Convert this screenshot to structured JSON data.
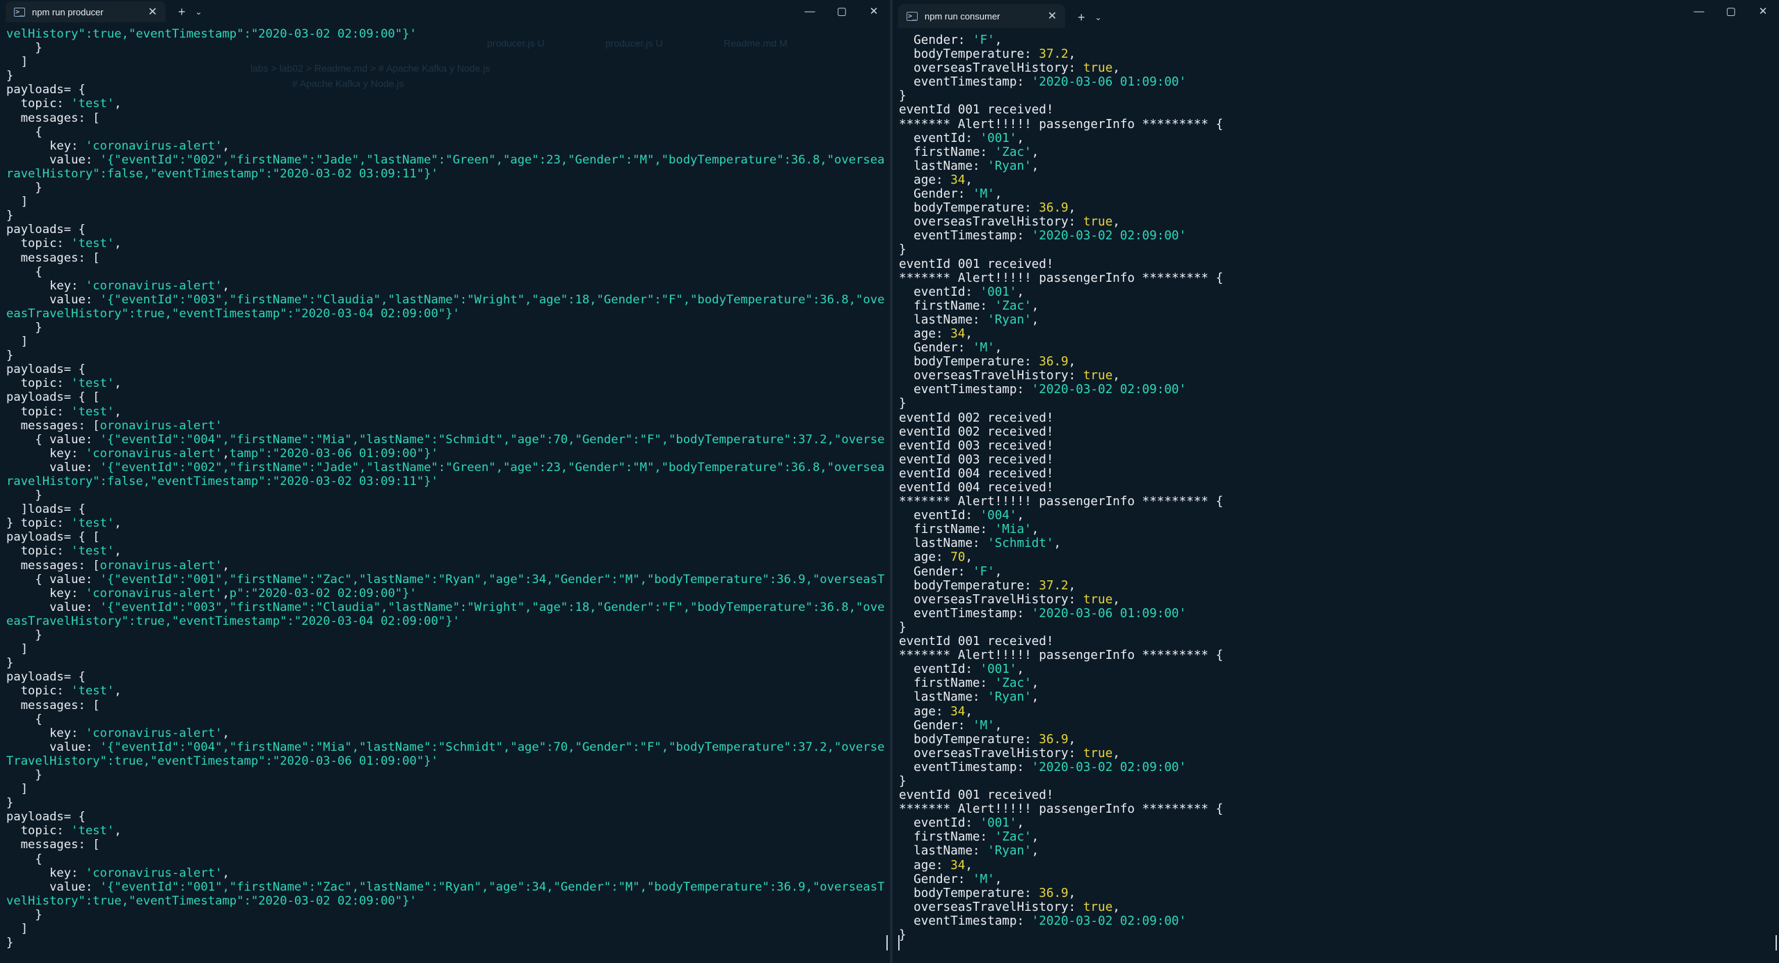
{
  "left_window": {
    "tab_title": "npm run producer",
    "tab_icon": "terminal-icon",
    "new_tab": "+",
    "dropdown": "⌄",
    "controls": {
      "minimize": "—",
      "maximize": "▢",
      "close": "✕"
    },
    "lines": [
      [
        {
          "t": "velHistory\":true,\"eventTimestamp\":\"2020-03-02 02:09:00\"}'",
          "c": "s"
        }
      ],
      [
        {
          "t": "    }"
        }
      ],
      [
        {
          "t": "  ]"
        }
      ],
      [
        {
          "t": "}"
        }
      ],
      [
        {
          "t": "payloads= {"
        }
      ],
      [
        {
          "t": "  topic: "
        },
        {
          "t": "'test'",
          "c": "s"
        },
        {
          "t": ","
        }
      ],
      [
        {
          "t": "  messages: ["
        }
      ],
      [
        {
          "t": "    {"
        }
      ],
      [
        {
          "t": "      key: "
        },
        {
          "t": "'coronavirus-alert'",
          "c": "s"
        },
        {
          "t": ","
        }
      ],
      [
        {
          "t": "      value: "
        },
        {
          "t": "'{\"eventId\":\"002\",\"firstName\":\"Jade\",\"lastName\":\"Green\",\"age\":23,\"Gender\":\"M\",\"bodyTemperature\":36.8,\"overseasT",
          "c": "s"
        }
      ],
      [
        {
          "t": "ravelHistory\":false,\"eventTimestamp\":\"2020-03-02 03:09:11\"}'",
          "c": "s"
        }
      ],
      [
        {
          "t": "    }"
        }
      ],
      [
        {
          "t": "  ]"
        }
      ],
      [
        {
          "t": "}"
        }
      ],
      [
        {
          "t": "payloads= {"
        }
      ],
      [
        {
          "t": "  topic: "
        },
        {
          "t": "'test'",
          "c": "s"
        },
        {
          "t": ","
        }
      ],
      [
        {
          "t": "  messages: ["
        }
      ],
      [
        {
          "t": "    {"
        }
      ],
      [
        {
          "t": "      key: "
        },
        {
          "t": "'coronavirus-alert'",
          "c": "s"
        },
        {
          "t": ","
        }
      ],
      [
        {
          "t": "      value: "
        },
        {
          "t": "'{\"eventId\":\"003\",\"firstName\":\"Claudia\",\"lastName\":\"Wright\",\"age\":18,\"Gender\":\"F\",\"bodyTemperature\":36.8,\"overs",
          "c": "s"
        }
      ],
      [
        {
          "t": "easTravelHistory\":true,\"eventTimestamp\":\"2020-03-04 02:09:00\"}'",
          "c": "s"
        }
      ],
      [
        {
          "t": "    }"
        }
      ],
      [
        {
          "t": "  ]"
        }
      ],
      [
        {
          "t": "}"
        }
      ],
      [
        {
          "t": "payloads= {"
        }
      ],
      [
        {
          "t": "  topic: "
        },
        {
          "t": "'test'",
          "c": "s"
        },
        {
          "t": ","
        }
      ],
      [
        {
          "t": "payloads= { ["
        }
      ],
      [
        {
          "t": "  topic: "
        },
        {
          "t": "'test'",
          "c": "s"
        },
        {
          "t": ","
        }
      ],
      [
        {
          "t": "  messages: ["
        },
        {
          "t": "oronavirus-alert'",
          "c": "s"
        }
      ],
      [
        {
          "t": "    { value: "
        },
        {
          "t": "'{\"eventId\":\"004\",\"firstName\":\"Mia\",\"lastName\":\"Schmidt\",\"age\":70,\"Gender\":\"F\",\"bodyTemperature\":37.2,\"overseas",
          "c": "s"
        }
      ],
      [
        {
          "t": "      key: "
        },
        {
          "t": "'coronavirus-alert'",
          "c": "s"
        },
        {
          "t": ","
        },
        {
          "t": "tamp\":\"2020-03-06 01:09:00\"}'",
          "c": "s"
        }
      ],
      [
        {
          "t": "      value: "
        },
        {
          "t": "'{\"eventId\":\"002\",\"firstName\":\"Jade\",\"lastName\":\"Green\",\"age\":23,\"Gender\":\"M\",\"bodyTemperature\":36.8,\"overseasT",
          "c": "s"
        }
      ],
      [
        {
          "t": "ravelHistory\":false,\"eventTimestamp\":\"2020-03-02 03:09:11\"}'",
          "c": "s"
        }
      ],
      [
        {
          "t": "    }"
        }
      ],
      [
        {
          "t": "  ]loads= {"
        }
      ],
      [
        {
          "t": "} topic: "
        },
        {
          "t": "'test'",
          "c": "s"
        },
        {
          "t": ","
        }
      ],
      [
        {
          "t": "payloads= { ["
        }
      ],
      [
        {
          "t": "  topic: "
        },
        {
          "t": "'test'",
          "c": "s"
        },
        {
          "t": ","
        }
      ],
      [
        {
          "t": "  messages: ["
        },
        {
          "t": "oronavirus-alert'",
          "c": "s"
        },
        {
          "t": ","
        }
      ],
      [
        {
          "t": "    { value: "
        },
        {
          "t": "'{\"eventId\":\"001\",\"firstName\":\"Zac\",\"lastName\":\"Ryan\",\"age\":34,\"Gender\":\"M\",\"bodyTemperature\":36.9,\"overseasTra",
          "c": "s"
        }
      ],
      [
        {
          "t": "      key: "
        },
        {
          "t": "'coronavirus-alert'",
          "c": "s"
        },
        {
          "t": ","
        },
        {
          "t": "p\":\"2020-03-02 02:09:00\"}'",
          "c": "s"
        }
      ],
      [
        {
          "t": "      value: "
        },
        {
          "t": "'{\"eventId\":\"003\",\"firstName\":\"Claudia\",\"lastName\":\"Wright\",\"age\":18,\"Gender\":\"F\",\"bodyTemperature\":36.8,\"overs",
          "c": "s"
        }
      ],
      [
        {
          "t": "easTravelHistory\":true,\"eventTimestamp\":\"2020-03-04 02:09:00\"}'",
          "c": "s"
        }
      ],
      [
        {
          "t": "    }"
        }
      ],
      [
        {
          "t": "  ]"
        }
      ],
      [
        {
          "t": "}"
        }
      ],
      [
        {
          "t": "payloads= {"
        }
      ],
      [
        {
          "t": "  topic: "
        },
        {
          "t": "'test'",
          "c": "s"
        },
        {
          "t": ","
        }
      ],
      [
        {
          "t": "  messages: ["
        }
      ],
      [
        {
          "t": "    {"
        }
      ],
      [
        {
          "t": "      key: "
        },
        {
          "t": "'coronavirus-alert'",
          "c": "s"
        },
        {
          "t": ","
        }
      ],
      [
        {
          "t": "      value: "
        },
        {
          "t": "'{\"eventId\":\"004\",\"firstName\":\"Mia\",\"lastName\":\"Schmidt\",\"age\":70,\"Gender\":\"F\",\"bodyTemperature\":37.2,\"overseas",
          "c": "s"
        }
      ],
      [
        {
          "t": "TravelHistory\":true,\"eventTimestamp\":\"2020-03-06 01:09:00\"}'",
          "c": "s"
        }
      ],
      [
        {
          "t": "    }"
        }
      ],
      [
        {
          "t": "  ]"
        }
      ],
      [
        {
          "t": "}"
        }
      ],
      [
        {
          "t": "payloads= {"
        }
      ],
      [
        {
          "t": "  topic: "
        },
        {
          "t": "'test'",
          "c": "s"
        },
        {
          "t": ","
        }
      ],
      [
        {
          "t": "  messages: ["
        }
      ],
      [
        {
          "t": "    {"
        }
      ],
      [
        {
          "t": "      key: "
        },
        {
          "t": "'coronavirus-alert'",
          "c": "s"
        },
        {
          "t": ","
        }
      ],
      [
        {
          "t": "      value: "
        },
        {
          "t": "'{\"eventId\":\"001\",\"firstName\":\"Zac\",\"lastName\":\"Ryan\",\"age\":34,\"Gender\":\"M\",\"bodyTemperature\":36.9,\"overseasTra",
          "c": "s"
        }
      ],
      [
        {
          "t": "velHistory\":true,\"eventTimestamp\":\"2020-03-02 02:09:00\"}'",
          "c": "s"
        }
      ],
      [
        {
          "t": "    }"
        }
      ],
      [
        {
          "t": "  ]"
        }
      ],
      [
        {
          "t": "}"
        }
      ]
    ]
  },
  "right_window": {
    "tab_title": "npm run consumer",
    "tab_icon": "terminal-icon",
    "new_tab": "+",
    "dropdown": "⌄",
    "controls": {
      "minimize": "—",
      "maximize": "▢",
      "close": "✕"
    },
    "lines": [
      [
        {
          "t": "  Gender: "
        },
        {
          "t": "'F'",
          "c": "s"
        },
        {
          "t": ","
        }
      ],
      [
        {
          "t": "  bodyTemperature: "
        },
        {
          "t": "37.2",
          "c": "n"
        },
        {
          "t": ","
        }
      ],
      [
        {
          "t": "  overseasTravelHistory: "
        },
        {
          "t": "true",
          "c": "b"
        },
        {
          "t": ","
        }
      ],
      [
        {
          "t": "  eventTimestamp: "
        },
        {
          "t": "'2020-03-06 01:09:00'",
          "c": "s"
        }
      ],
      [
        {
          "t": "}"
        }
      ],
      [
        {
          "t": "eventId 001 received!"
        }
      ],
      [
        {
          "t": "******* Alert!!!!! passengerInfo ********* {"
        }
      ],
      [
        {
          "t": "  eventId: "
        },
        {
          "t": "'001'",
          "c": "s"
        },
        {
          "t": ","
        }
      ],
      [
        {
          "t": "  firstName: "
        },
        {
          "t": "'Zac'",
          "c": "s"
        },
        {
          "t": ","
        }
      ],
      [
        {
          "t": "  lastName: "
        },
        {
          "t": "'Ryan'",
          "c": "s"
        },
        {
          "t": ","
        }
      ],
      [
        {
          "t": "  age: "
        },
        {
          "t": "34",
          "c": "n"
        },
        {
          "t": ","
        }
      ],
      [
        {
          "t": "  Gender: "
        },
        {
          "t": "'M'",
          "c": "s"
        },
        {
          "t": ","
        }
      ],
      [
        {
          "t": "  bodyTemperature: "
        },
        {
          "t": "36.9",
          "c": "n"
        },
        {
          "t": ","
        }
      ],
      [
        {
          "t": "  overseasTravelHistory: "
        },
        {
          "t": "true",
          "c": "b"
        },
        {
          "t": ","
        }
      ],
      [
        {
          "t": "  eventTimestamp: "
        },
        {
          "t": "'2020-03-02 02:09:00'",
          "c": "s"
        }
      ],
      [
        {
          "t": "}"
        }
      ],
      [
        {
          "t": "eventId 001 received!"
        }
      ],
      [
        {
          "t": "******* Alert!!!!! passengerInfo ********* {"
        }
      ],
      [
        {
          "t": "  eventId: "
        },
        {
          "t": "'001'",
          "c": "s"
        },
        {
          "t": ","
        }
      ],
      [
        {
          "t": "  firstName: "
        },
        {
          "t": "'Zac'",
          "c": "s"
        },
        {
          "t": ","
        }
      ],
      [
        {
          "t": "  lastName: "
        },
        {
          "t": "'Ryan'",
          "c": "s"
        },
        {
          "t": ","
        }
      ],
      [
        {
          "t": "  age: "
        },
        {
          "t": "34",
          "c": "n"
        },
        {
          "t": ","
        }
      ],
      [
        {
          "t": "  Gender: "
        },
        {
          "t": "'M'",
          "c": "s"
        },
        {
          "t": ","
        }
      ],
      [
        {
          "t": "  bodyTemperature: "
        },
        {
          "t": "36.9",
          "c": "n"
        },
        {
          "t": ","
        }
      ],
      [
        {
          "t": "  overseasTravelHistory: "
        },
        {
          "t": "true",
          "c": "b"
        },
        {
          "t": ","
        }
      ],
      [
        {
          "t": "  eventTimestamp: "
        },
        {
          "t": "'2020-03-02 02:09:00'",
          "c": "s"
        }
      ],
      [
        {
          "t": "}"
        }
      ],
      [
        {
          "t": "eventId 002 received!"
        }
      ],
      [
        {
          "t": "eventId 002 received!"
        }
      ],
      [
        {
          "t": "eventId 003 received!"
        }
      ],
      [
        {
          "t": "eventId 003 received!"
        }
      ],
      [
        {
          "t": "eventId 004 received!"
        }
      ],
      [
        {
          "t": "eventId 004 received!"
        }
      ],
      [
        {
          "t": "******* Alert!!!!! passengerInfo ********* {"
        }
      ],
      [
        {
          "t": "  eventId: "
        },
        {
          "t": "'004'",
          "c": "s"
        },
        {
          "t": ","
        }
      ],
      [
        {
          "t": "  firstName: "
        },
        {
          "t": "'Mia'",
          "c": "s"
        },
        {
          "t": ","
        }
      ],
      [
        {
          "t": "  lastName: "
        },
        {
          "t": "'Schmidt'",
          "c": "s"
        },
        {
          "t": ","
        }
      ],
      [
        {
          "t": "  age: "
        },
        {
          "t": "70",
          "c": "n"
        },
        {
          "t": ","
        }
      ],
      [
        {
          "t": "  Gender: "
        },
        {
          "t": "'F'",
          "c": "s"
        },
        {
          "t": ","
        }
      ],
      [
        {
          "t": "  bodyTemperature: "
        },
        {
          "t": "37.2",
          "c": "n"
        },
        {
          "t": ","
        }
      ],
      [
        {
          "t": "  overseasTravelHistory: "
        },
        {
          "t": "true",
          "c": "b"
        },
        {
          "t": ","
        }
      ],
      [
        {
          "t": "  eventTimestamp: "
        },
        {
          "t": "'2020-03-06 01:09:00'",
          "c": "s"
        }
      ],
      [
        {
          "t": "}"
        }
      ],
      [
        {
          "t": "eventId 001 received!"
        }
      ],
      [
        {
          "t": "******* Alert!!!!! passengerInfo ********* {"
        }
      ],
      [
        {
          "t": "  eventId: "
        },
        {
          "t": "'001'",
          "c": "s"
        },
        {
          "t": ","
        }
      ],
      [
        {
          "t": "  firstName: "
        },
        {
          "t": "'Zac'",
          "c": "s"
        },
        {
          "t": ","
        }
      ],
      [
        {
          "t": "  lastName: "
        },
        {
          "t": "'Ryan'",
          "c": "s"
        },
        {
          "t": ","
        }
      ],
      [
        {
          "t": "  age: "
        },
        {
          "t": "34",
          "c": "n"
        },
        {
          "t": ","
        }
      ],
      [
        {
          "t": "  Gender: "
        },
        {
          "t": "'M'",
          "c": "s"
        },
        {
          "t": ","
        }
      ],
      [
        {
          "t": "  bodyTemperature: "
        },
        {
          "t": "36.9",
          "c": "n"
        },
        {
          "t": ","
        }
      ],
      [
        {
          "t": "  overseasTravelHistory: "
        },
        {
          "t": "true",
          "c": "b"
        },
        {
          "t": ","
        }
      ],
      [
        {
          "t": "  eventTimestamp: "
        },
        {
          "t": "'2020-03-02 02:09:00'",
          "c": "s"
        }
      ],
      [
        {
          "t": "}"
        }
      ],
      [
        {
          "t": "eventId 001 received!"
        }
      ],
      [
        {
          "t": "******* Alert!!!!! passengerInfo ********* {"
        }
      ],
      [
        {
          "t": "  eventId: "
        },
        {
          "t": "'001'",
          "c": "s"
        },
        {
          "t": ","
        }
      ],
      [
        {
          "t": "  firstName: "
        },
        {
          "t": "'Zac'",
          "c": "s"
        },
        {
          "t": ","
        }
      ],
      [
        {
          "t": "  lastName: "
        },
        {
          "t": "'Ryan'",
          "c": "s"
        },
        {
          "t": ","
        }
      ],
      [
        {
          "t": "  age: "
        },
        {
          "t": "34",
          "c": "n"
        },
        {
          "t": ","
        }
      ],
      [
        {
          "t": "  Gender: "
        },
        {
          "t": "'M'",
          "c": "s"
        },
        {
          "t": ","
        }
      ],
      [
        {
          "t": "  bodyTemperature: "
        },
        {
          "t": "36.9",
          "c": "n"
        },
        {
          "t": ","
        }
      ],
      [
        {
          "t": "  overseasTravelHistory: "
        },
        {
          "t": "true",
          "c": "b"
        },
        {
          "t": ","
        }
      ],
      [
        {
          "t": "  eventTimestamp: "
        },
        {
          "t": "'2020-03-02 02:09:00'",
          "c": "s"
        }
      ],
      [
        {
          "t": "}"
        }
      ]
    ]
  },
  "colors": {
    "background": "#0c1a26",
    "text": "#e9edf1",
    "string": "#2fd7b8",
    "number": "#e8d53a"
  },
  "background_editor": {
    "tabs": [
      "producer.js U",
      "producer.js U",
      "Readme.md M"
    ],
    "breadcrumb": "labs > lab02 > Readme.md > # Apache Kafka y Node.js",
    "heading": "# Apache Kafka y Node.js"
  }
}
